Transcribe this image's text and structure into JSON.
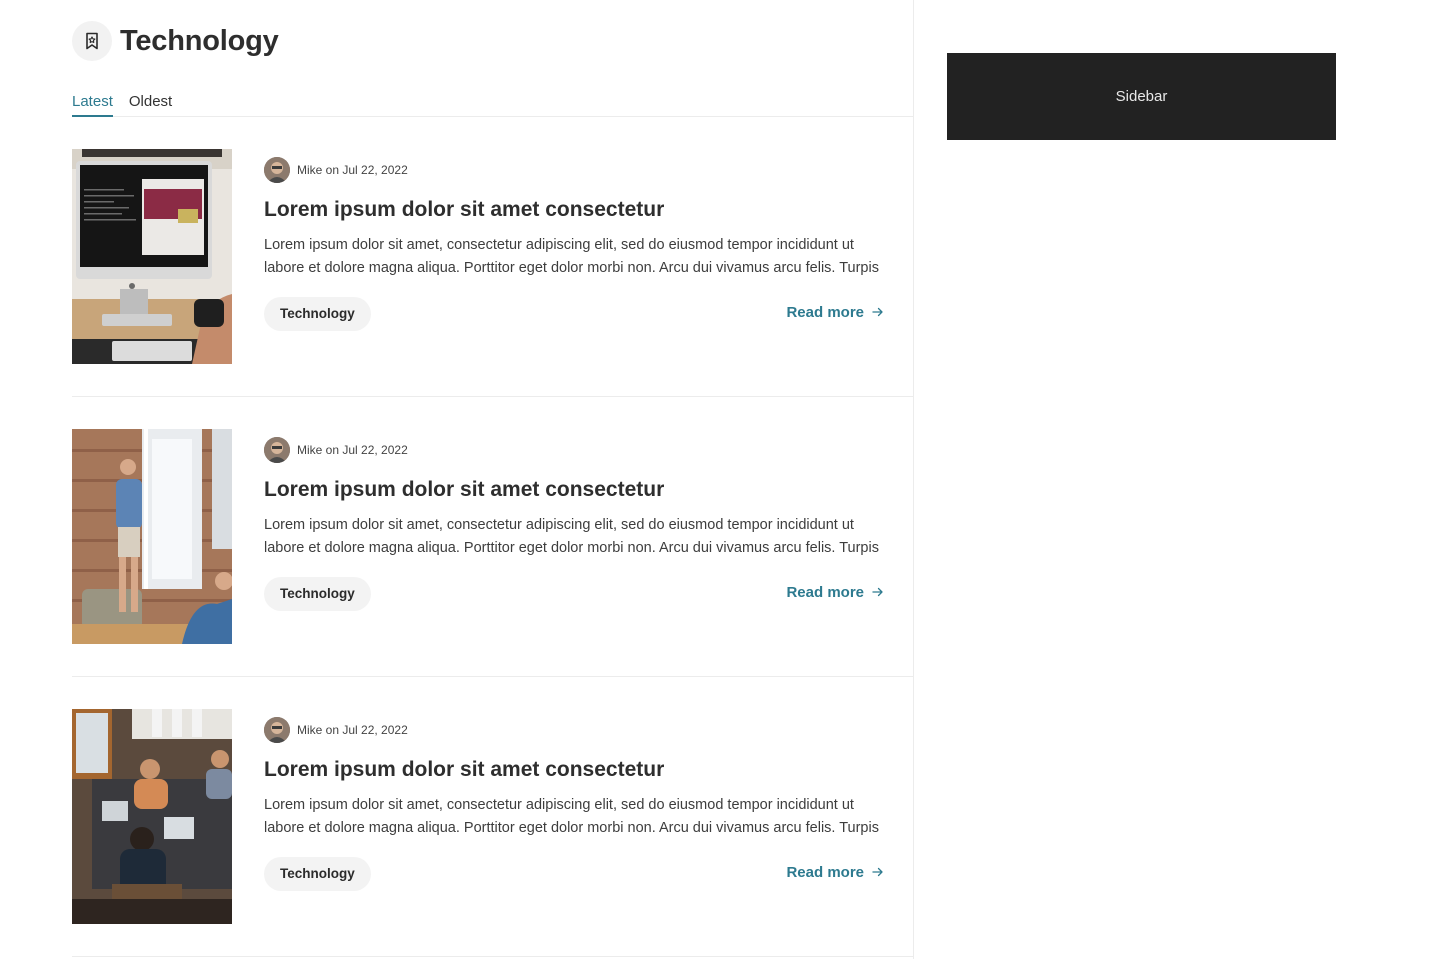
{
  "category": {
    "title": "Technology",
    "icon": "bookmark-icon"
  },
  "tabs": [
    {
      "label": "Latest",
      "active": true
    },
    {
      "label": "Oldest",
      "active": false
    }
  ],
  "posts": [
    {
      "meta": "Mike on Jul 22, 2022",
      "title": "Lorem ipsum dolor sit amet consectetur",
      "excerpt": "Lorem ipsum dolor sit amet, consectetur adipiscing elit, sed do eiusmod tempor incididunt ut labore et dolore magna aliqua. Porttitor eget dolor morbi non. Arcu dui vivamus arcu felis. Turpis",
      "tag": "Technology",
      "read_more": "Read more"
    },
    {
      "meta": "Mike on Jul 22, 2022",
      "title": "Lorem ipsum dolor sit amet consectetur",
      "excerpt": "Lorem ipsum dolor sit amet, consectetur adipiscing elit, sed do eiusmod tempor incididunt ut labore et dolore magna aliqua. Porttitor eget dolor morbi non. Arcu dui vivamus arcu felis. Turpis",
      "tag": "Technology",
      "read_more": "Read more"
    },
    {
      "meta": "Mike on Jul 22, 2022",
      "title": "Lorem ipsum dolor sit amet consectetur",
      "excerpt": "Lorem ipsum dolor sit amet, consectetur adipiscing elit, sed do eiusmod tempor incididunt ut labore et dolore magna aliqua. Porttitor eget dolor morbi non. Arcu dui vivamus arcu felis. Turpis",
      "tag": "Technology",
      "read_more": "Read more"
    }
  ],
  "sidebar": {
    "label": "Sidebar"
  },
  "colors": {
    "accent": "#2d7a8f",
    "sidebar_bg": "#222222",
    "tag_bg": "#f3f3f3"
  }
}
